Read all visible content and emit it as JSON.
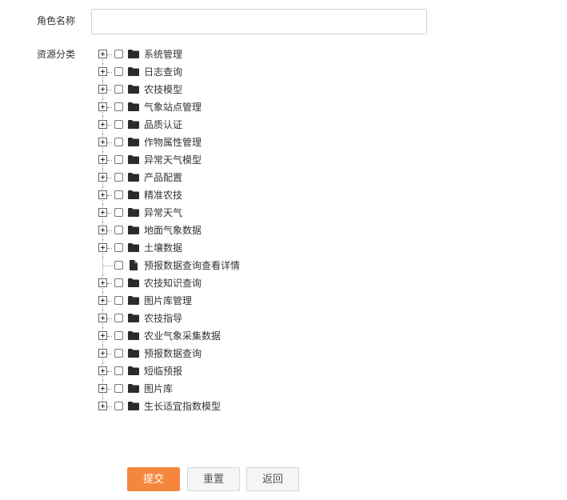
{
  "form": {
    "role_name_label": "角色名称",
    "role_name_value": "",
    "resource_label": "资源分类"
  },
  "tree": {
    "nodes": [
      {
        "label": "系统管理",
        "icon": "folder-icon",
        "expandable": true,
        "checked": false
      },
      {
        "label": "日志查询",
        "icon": "folder-icon",
        "expandable": true,
        "checked": false
      },
      {
        "label": "农技模型",
        "icon": "folder-icon",
        "expandable": true,
        "checked": false
      },
      {
        "label": "气象站点管理",
        "icon": "folder-icon",
        "expandable": true,
        "checked": false
      },
      {
        "label": "品质认证",
        "icon": "folder-icon",
        "expandable": true,
        "checked": false
      },
      {
        "label": "作物属性管理",
        "icon": "folder-icon",
        "expandable": true,
        "checked": false
      },
      {
        "label": "异常天气模型",
        "icon": "folder-icon",
        "expandable": true,
        "checked": false
      },
      {
        "label": "产品配置",
        "icon": "folder-icon",
        "expandable": true,
        "checked": false
      },
      {
        "label": "精准农技",
        "icon": "folder-icon",
        "expandable": true,
        "checked": false
      },
      {
        "label": "异常天气",
        "icon": "folder-icon",
        "expandable": true,
        "checked": false
      },
      {
        "label": "地面气象数据",
        "icon": "folder-icon",
        "expandable": true,
        "checked": false
      },
      {
        "label": "土壤数据",
        "icon": "folder-icon",
        "expandable": true,
        "checked": false
      },
      {
        "label": "预报数据查询查看详情",
        "icon": "file-icon",
        "expandable": false,
        "checked": false
      },
      {
        "label": "农技知识查询",
        "icon": "folder-icon",
        "expandable": true,
        "checked": false
      },
      {
        "label": "图片库管理",
        "icon": "folder-icon",
        "expandable": true,
        "checked": false
      },
      {
        "label": "农技指导",
        "icon": "folder-icon",
        "expandable": true,
        "checked": false
      },
      {
        "label": "农业气象采集数据",
        "icon": "folder-icon",
        "expandable": true,
        "checked": false
      },
      {
        "label": "预报数据查询",
        "icon": "folder-icon",
        "expandable": true,
        "checked": false
      },
      {
        "label": "短临预报",
        "icon": "folder-icon",
        "expandable": true,
        "checked": false
      },
      {
        "label": "图片库",
        "icon": "folder-icon",
        "expandable": true,
        "checked": false
      },
      {
        "label": "生长适宜指数模型",
        "icon": "folder-icon",
        "expandable": true,
        "checked": false
      }
    ]
  },
  "buttons": {
    "submit": "提交",
    "reset": "重置",
    "back": "返回"
  },
  "colors": {
    "submit_bg": "#f5873d",
    "border": "#d2d2d2"
  }
}
